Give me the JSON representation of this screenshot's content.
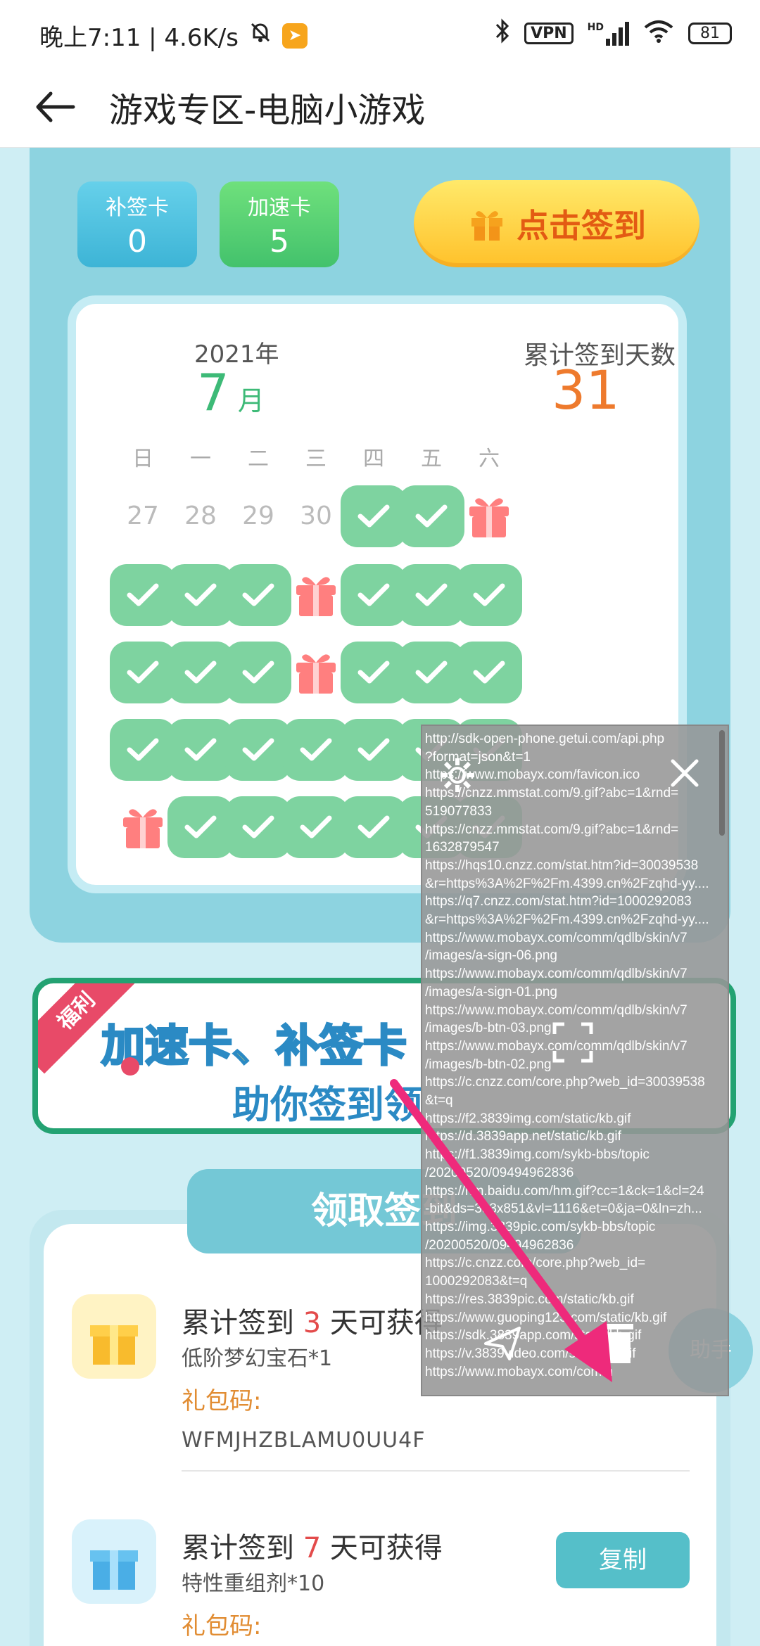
{
  "status_bar": {
    "time": "晚上7:11 | 4.6K/s",
    "vpn": "VPN",
    "signal_label": "HD",
    "battery": "81"
  },
  "header": {
    "title": "游戏专区-电脑小游戏"
  },
  "cards": {
    "makeup": {
      "label": "补签卡",
      "count": "0"
    },
    "speedup": {
      "label": "加速卡",
      "count": "5"
    },
    "signin_button": "点击签到"
  },
  "calendar": {
    "year": "2021年",
    "month_num": "7",
    "month_unit": "月",
    "total_label": "累计签到天数",
    "total_days": "31",
    "weekdays": [
      "日",
      "一",
      "二",
      "三",
      "四",
      "五",
      "六"
    ],
    "prev_days": [
      "27",
      "28",
      "29",
      "30"
    ],
    "colors": {
      "check": "#7ed3a0",
      "gift": "#ff7f7f"
    }
  },
  "banner": {
    "ribbon": "福利",
    "line1": "加速卡、补签卡",
    "line2": "助你签到领"
  },
  "rewards": {
    "tab_title": "领取签到",
    "items": [
      {
        "title_prefix": "累计签到",
        "days": "3",
        "title_suffix": "天可获得",
        "item": "低阶梦幻宝石*1",
        "code_label": "礼包码:",
        "code": "WFMJHZBLAMU0UU4F"
      },
      {
        "title_prefix": "累计签到",
        "days": "7",
        "title_suffix": "天可获得",
        "item": "特性重组剂*10",
        "code_label": "礼包码:",
        "copy": "复制"
      }
    ]
  },
  "assistant": {
    "label": "助手"
  },
  "overlay": {
    "log": [
      "http://sdk-open-phone.getui.com/api.php",
      "?format=json&t=1",
      "https://www.mobayx.com/favicon.ico",
      "https://cnzz.mmstat.com/9.gif?abc=1&rnd=",
      "519077833",
      "https://cnzz.mmstat.com/9.gif?abc=1&rnd=",
      "1632879547",
      "https://hqs10.cnzz.com/stat.htm?id=30039538",
      "&r=https%3A%2F%2Fm.4399.cn%2Fzqhd-yy....",
      "https://q7.cnzz.com/stat.htm?id=1000292083",
      "&r=https%3A%2F%2Fm.4399.cn%2Fzqhd-yy....",
      "https://www.mobayx.com/comm/qdlb/skin/v7",
      "/images/a-sign-06.png",
      "https://www.mobayx.com/comm/qdlb/skin/v7",
      "/images/a-sign-01.png",
      "https://www.mobayx.com/comm/qdlb/skin/v7",
      "/images/b-btn-03.png",
      "https://www.mobayx.com/comm/qdlb/skin/v7",
      "/images/b-btn-02.png",
      "https://c.cnzz.com/core.php?web_id=30039538",
      "&t=q",
      "https://f2.3839img.com/static/kb.gif",
      "https://d.3839app.net/static/kb.gif",
      "https://f1.3839img.com/sykb-bbs/topic",
      "/20200520/09494962836",
      "https://hm.baidu.com/hm.gif?cc=1&ck=1&cl=24",
      "-bit&ds=393x851&vl=1116&et=0&ja=0&ln=zh...",
      "https://img.3839pic.com/sykb-bbs/topic",
      "/20200520/09494962836",
      "https://c.cnzz.com/core.php?web_id=",
      "1000292083&t=q",
      "https://res.3839pic.com/static/kb.gif",
      "https://www.guoping123.com/static/kb.gif",
      "https://sdk.3839app.com/static/kb.gif",
      "https://v.3839video.com/static/kb.gif",
      "https://www.mobayx.com/comm"
    ]
  }
}
